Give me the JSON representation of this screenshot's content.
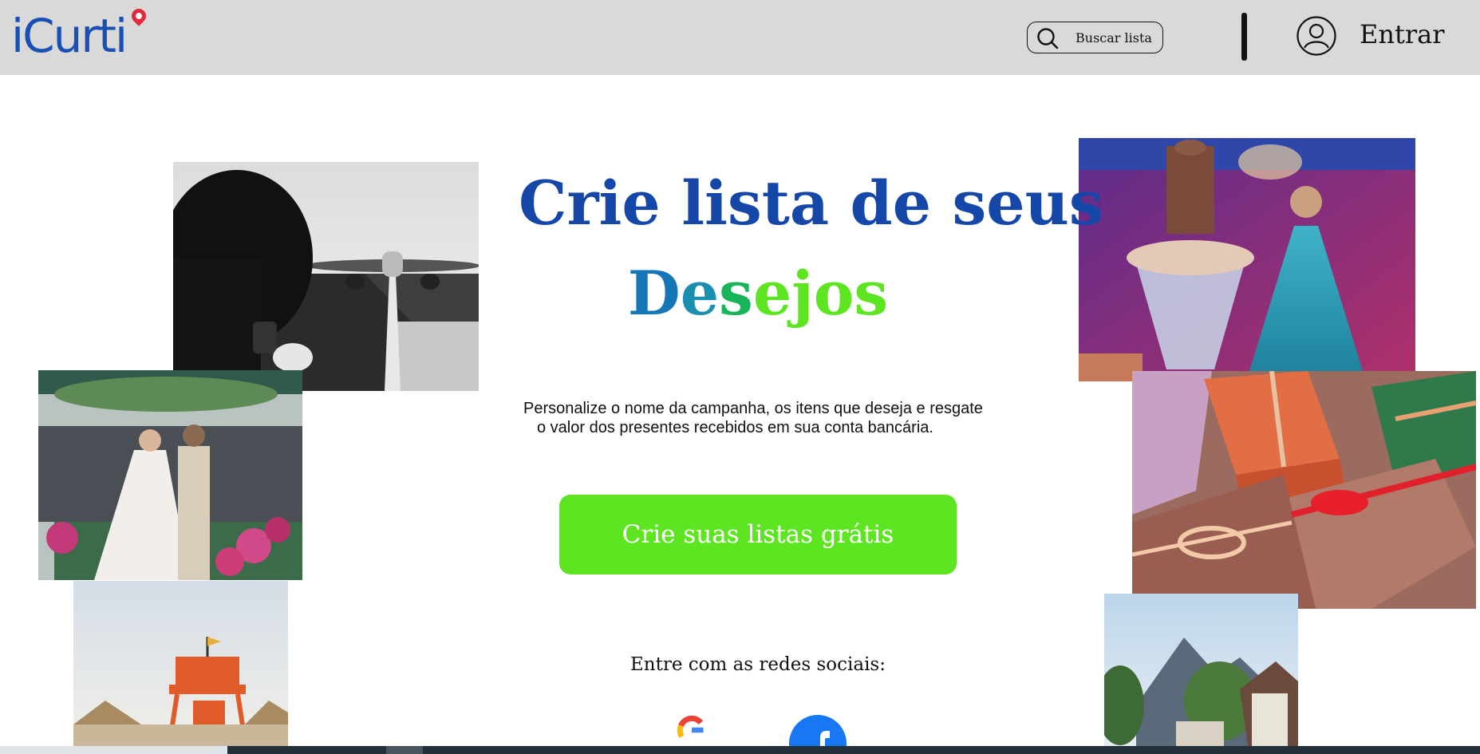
{
  "header": {
    "logo_text": "iCurti",
    "search_placeholder": "Buscar lista",
    "login_label": "Entrar"
  },
  "hero": {
    "title": "Crie lista de seus",
    "subtitle_letters": [
      {
        "char": "D",
        "color": "#1577b8"
      },
      {
        "char": "e",
        "color": "#1a8fb0"
      },
      {
        "char": "s",
        "color": "#19b45a"
      },
      {
        "char": "e",
        "color": "#5de521"
      },
      {
        "char": "j",
        "color": "#5de521"
      },
      {
        "char": "o",
        "color": "#5de521"
      },
      {
        "char": "s",
        "color": "#5de521"
      }
    ],
    "description_line1": "Personalize o nome da campanha, os itens que deseja e resgate",
    "description_line2": "o valor dos presentes recebidos em sua conta bancária.",
    "cta_label": "Crie suas listas grátis"
  },
  "social": {
    "label": "Entre com as redes sociais:",
    "providers": [
      "google-icon",
      "facebook-icon"
    ]
  },
  "colors": {
    "header_bg": "#d9d9d9",
    "brand_blue": "#1547a8",
    "cta_green": "#5de521"
  }
}
